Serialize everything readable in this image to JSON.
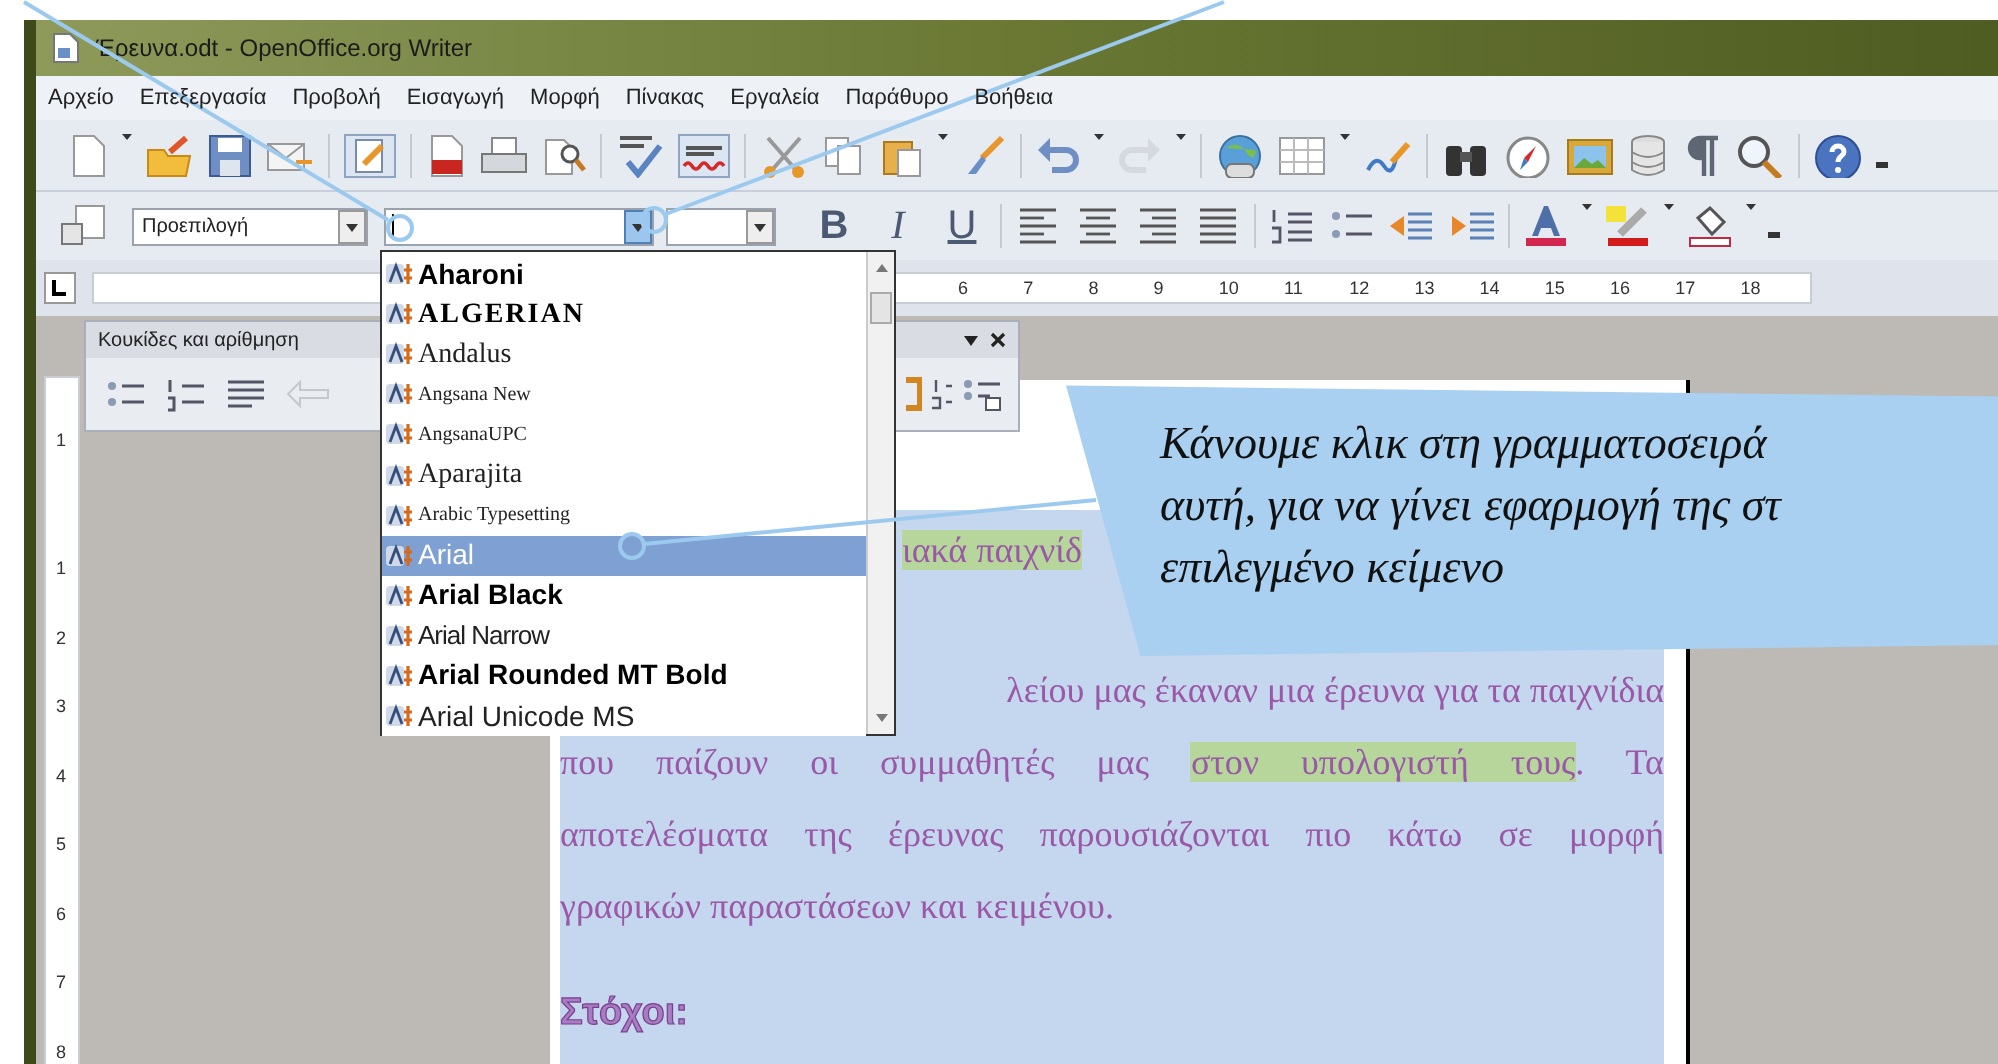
{
  "window": {
    "title": "Έρευνα.odt - OpenOffice.org Writer"
  },
  "menu": [
    "Αρχείο",
    "Επεξεργασία",
    "Προβολή",
    "Εισαγωγή",
    "Μορφή",
    "Πίνακας",
    "Εργαλεία",
    "Παράθυρο",
    "Βοήθεια"
  ],
  "formatting": {
    "paragraph_style": "Προεπιλογή",
    "format_buttons": [
      {
        "label": "B",
        "kind": "bold"
      },
      {
        "label": "I",
        "kind": "italic"
      },
      {
        "label": "U",
        "kind": "underline"
      }
    ]
  },
  "ruler": {
    "horizontal": [
      "6",
      "7",
      "8",
      "9",
      "10",
      "11",
      "12",
      "13",
      "14",
      "15",
      "16",
      "17",
      "18"
    ],
    "vertical": [
      "1",
      "1",
      "2",
      "3",
      "4",
      "5",
      "6",
      "7",
      "8"
    ]
  },
  "panel": {
    "title": "Κουκίδες και αρίθμηση"
  },
  "font_list": [
    {
      "name": "Aharoni",
      "kind": "bold-sans",
      "selected": false
    },
    {
      "name": "ALGERIAN",
      "kind": "caps-serif",
      "selected": false
    },
    {
      "name": "Andalus",
      "kind": "serif",
      "selected": false
    },
    {
      "name": "Angsana New",
      "kind": "small-serif",
      "selected": false
    },
    {
      "name": "AngsanaUPC",
      "kind": "small-serif",
      "selected": false
    },
    {
      "name": "Aparajita",
      "kind": "serif",
      "selected": false
    },
    {
      "name": "Arabic Typesetting",
      "kind": "small-serif",
      "selected": false
    },
    {
      "name": "Arial",
      "kind": "sans",
      "selected": true
    },
    {
      "name": "Arial Black",
      "kind": "bold-sans",
      "selected": false
    },
    {
      "name": "Arial Narrow",
      "kind": "narrow-sans",
      "selected": false
    },
    {
      "name": "Arial Rounded MT Bold",
      "kind": "bold-sans",
      "selected": false
    },
    {
      "name": "Arial Unicode MS",
      "kind": "sans",
      "selected": false
    }
  ],
  "document": {
    "lines": [
      {
        "kind": "offset",
        "segments": [
          {
            "text": "ιακά παιχνίδ",
            "highlighted": true
          }
        ]
      },
      {
        "kind": "right",
        "segments": [
          {
            "text": "λείου μας έκαναν μια έρευνα για τα παιχνίδια",
            "highlighted": false
          }
        ]
      },
      {
        "kind": "justify",
        "segments": [
          {
            "text": "που παίζουν οι συμμαθητές μας ",
            "highlighted": false
          },
          {
            "text": "στον υπολογιστή τους",
            "highlighted": true
          },
          {
            "text": ". Τα",
            "highlighted": false
          }
        ]
      },
      {
        "kind": "justify",
        "segments": [
          {
            "text": "αποτελέσματα της έρευνας παρουσιάζονται πιο κάτω σε μορφή",
            "highlighted": false
          }
        ]
      },
      {
        "kind": "left",
        "segments": [
          {
            "text": "γραφικών παραστάσεων και κειμένου.",
            "highlighted": false
          }
        ]
      }
    ],
    "heading": "Στόχοι:"
  },
  "callout": {
    "text": "Κάνουμε κλικ στη γραμματοσειρά\nαυτή, για να γίνει εφαρμογή της στ\nεπιλεγμένο κείμενο"
  }
}
